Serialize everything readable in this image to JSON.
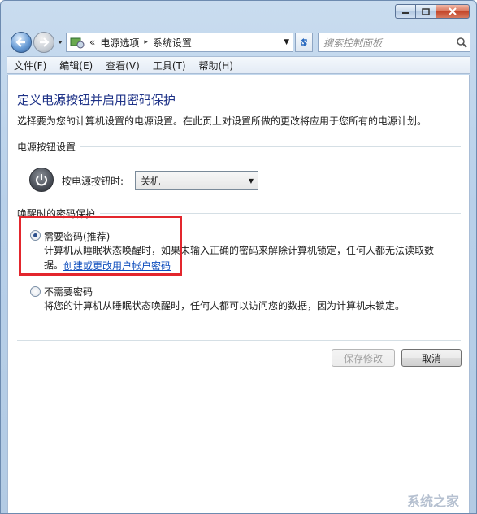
{
  "window": {
    "caption_buttons": {
      "minimize": "minimize-icon",
      "maximize": "maximize-icon",
      "close": "close-icon"
    }
  },
  "address_bar": {
    "overflow": "«",
    "breadcrumbs": [
      "电源选项",
      "系统设置"
    ],
    "separator": "▸",
    "search_placeholder": "搜索控制面板"
  },
  "menu": [
    "文件(F)",
    "编辑(E)",
    "查看(V)",
    "工具(T)",
    "帮助(H)"
  ],
  "page": {
    "title": "定义电源按钮并启用密码保护",
    "description": "选择要为您的计算机设置的电源设置。在此页上对设置所做的更改将应用于您所有的电源计划。"
  },
  "power_button_section": {
    "heading": "电源按钮设置",
    "label": "按电源按钮时:",
    "selected": "关机"
  },
  "password_section": {
    "heading": "唤醒时的密码保护",
    "require": {
      "label": "需要密码(推荐)",
      "checked": true,
      "desc_line1": "计算机从睡眠状态唤醒时，如果未输入正确的密码来解除计算机锁定，任何人都无法读取数",
      "desc_line2_prefix": "据。",
      "link": "创建或更改用户帐户密码"
    },
    "no_require": {
      "label": "不需要密码",
      "checked": false,
      "desc": "将您的计算机从睡眠状态唤醒时，任何人都可以访问您的数据，因为计算机未锁定。"
    }
  },
  "buttons": {
    "save": "保存修改",
    "cancel": "取消"
  },
  "watermark": "系统之家",
  "colors": {
    "title": "#1e3287",
    "link": "#0c4cbd",
    "highlight": "#e3262d"
  }
}
